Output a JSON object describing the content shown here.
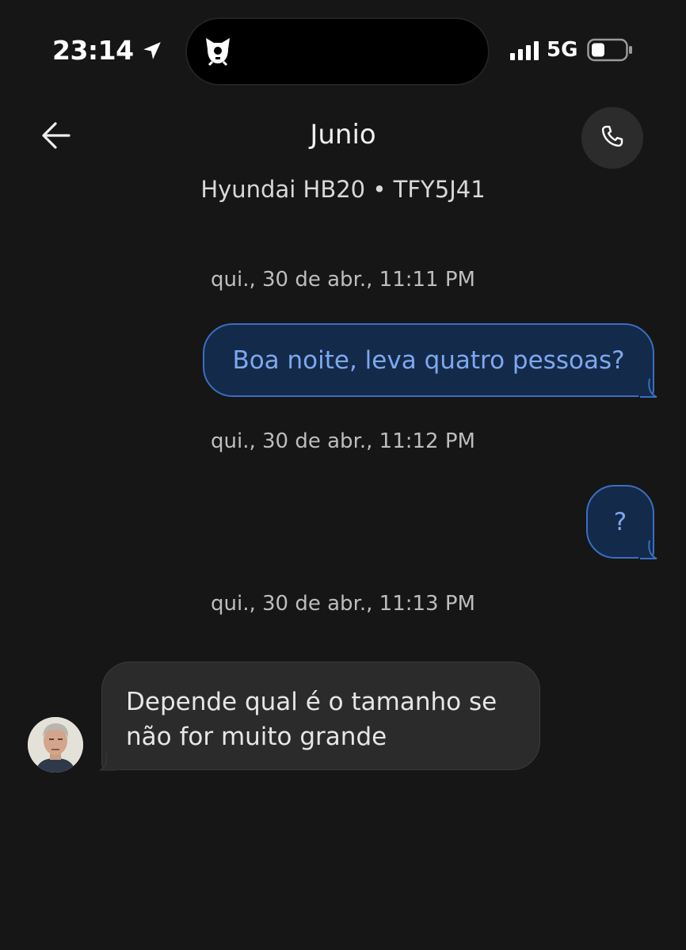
{
  "status_bar": {
    "time": "23:14",
    "network": "5G"
  },
  "header": {
    "contact_name": "Junio",
    "vehicle_info": "Hyundai HB20 • TFY5J41"
  },
  "messages": [
    {
      "timestamp": "qui., 30 de abr., 11:11 PM",
      "direction": "outgoing",
      "text": "Boa noite, leva quatro pessoas?"
    },
    {
      "timestamp": "qui., 30 de abr., 11:12 PM",
      "direction": "outgoing",
      "text": "?"
    },
    {
      "timestamp": "qui., 30 de abr., 11:13 PM",
      "direction": "incoming",
      "text": "Depende qual é o tamanho se não for muito grande"
    }
  ],
  "colors": {
    "background": "#161616",
    "outgoing_bubble": "#142a4a",
    "outgoing_border": "#3a6ec2",
    "outgoing_text": "#7ea8ee",
    "incoming_bubble": "#2b2b2b"
  },
  "icons": {
    "back": "arrow-left-icon",
    "call": "phone-icon",
    "location": "location-arrow-icon",
    "battery": "battery-icon",
    "signal": "cellular-signal-icon"
  }
}
